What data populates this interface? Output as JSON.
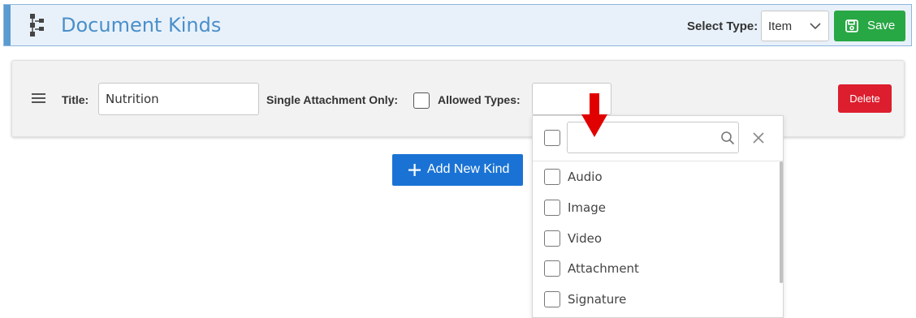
{
  "header": {
    "title": "Document Kinds",
    "icon": "tree-structure-icon",
    "select_type_label": "Select Type:",
    "select_type_value": "Item",
    "save_label": "Save",
    "accent_color": "#4a8fc9"
  },
  "kind": {
    "title_label": "Title:",
    "title_value": "Nutrition",
    "single_attachment_label": "Single Attachment Only:",
    "single_attachment_checked": false,
    "allowed_types_label": "Allowed Types:",
    "delete_label": "Delete"
  },
  "add_button_label": "Add New Kind",
  "allowed_types_dropdown": {
    "search_placeholder": "",
    "options": [
      {
        "label": "Audio",
        "checked": false
      },
      {
        "label": "Image",
        "checked": false
      },
      {
        "label": "Video",
        "checked": false
      },
      {
        "label": "Attachment",
        "checked": false
      },
      {
        "label": "Signature",
        "checked": false
      }
    ]
  },
  "colors": {
    "save": "#28a745",
    "delete": "#dc1e2e",
    "add": "#1a73d4",
    "annotation_arrow": "#e00000"
  }
}
